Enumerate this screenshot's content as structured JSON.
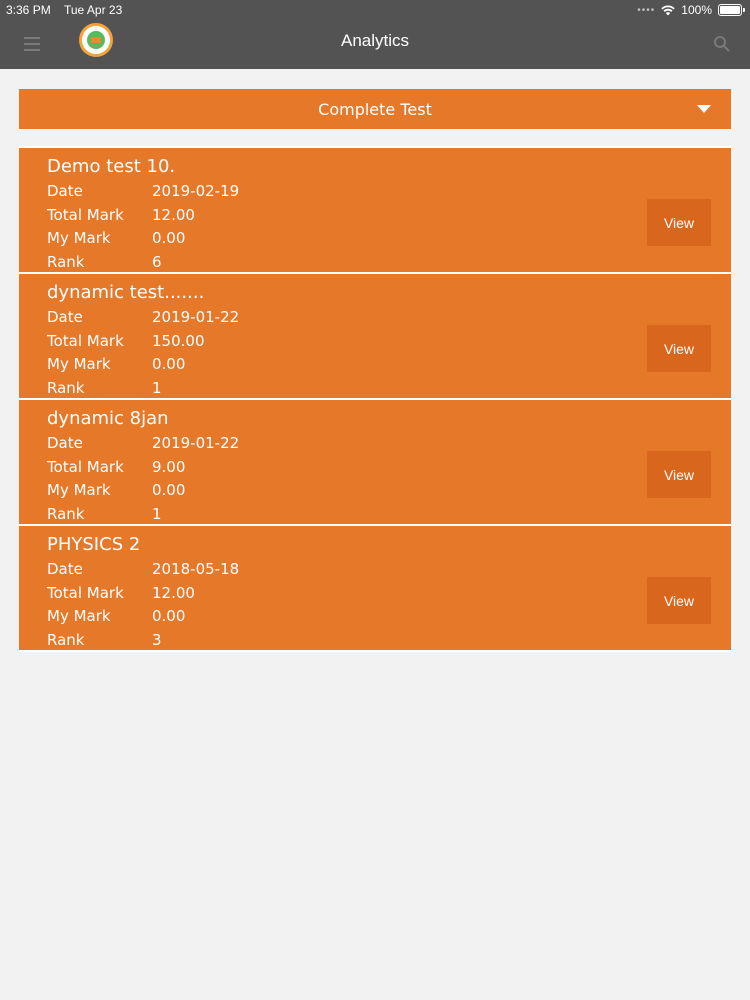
{
  "status": {
    "time": "3:36 PM",
    "date": "Tue Apr 23",
    "battery": "100%"
  },
  "header": {
    "title": "Analytics"
  },
  "filter": {
    "selected": "Complete Test"
  },
  "labels": {
    "date": "Date",
    "total": "Total Mark",
    "mine": "My Mark",
    "rank": "Rank",
    "view": "View"
  },
  "tests": [
    {
      "name": "Demo test 10.",
      "date": "2019-02-19",
      "total": "12.00",
      "mine": "0.00",
      "rank": "6"
    },
    {
      "name": "dynamic test.......",
      "date": "2019-01-22",
      "total": "150.00",
      "mine": "0.00",
      "rank": "1"
    },
    {
      "name": "dynamic 8jan",
      "date": "2019-01-22",
      "total": "9.00",
      "mine": "0.00",
      "rank": "1"
    },
    {
      "name": "PHYSICS 2",
      "date": "2018-05-18",
      "total": "12.00",
      "mine": "0.00",
      "rank": "3"
    }
  ]
}
